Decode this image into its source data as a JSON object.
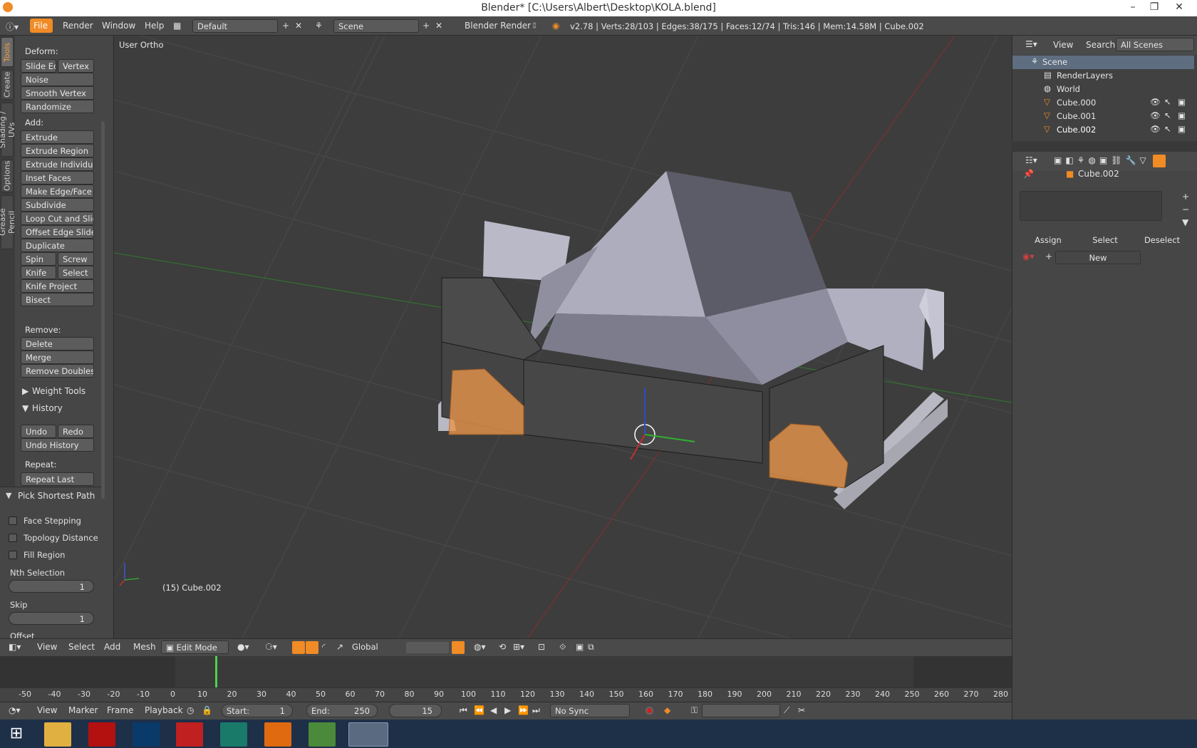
{
  "window": {
    "title": "Blender* [C:\\Users\\Albert\\Desktop\\KOLA.blend]",
    "min": "–",
    "max": "❐",
    "close": "✕"
  },
  "info": {
    "menus": [
      "File",
      "Render",
      "Window",
      "Help"
    ],
    "layout": "Default",
    "scene": "Scene",
    "engine": "Blender Render",
    "stats": "v2.78 | Verts:28/103 | Edges:38/175 | Faces:12/74 | Tris:146 | Mem:14.58M | Cube.002"
  },
  "tabs": [
    "Tools",
    "Create",
    "Shading / UVs",
    "Options",
    "Grease Pencil"
  ],
  "tools": {
    "deform": "Deform:",
    "slide_edge": "Slide Ed",
    "vertex": "Vertex",
    "noise": "Noise",
    "smooth_vertex": "Smooth Vertex",
    "randomize": "Randomize",
    "add": "Add:",
    "extrude": "Extrude",
    "extrude_region": "Extrude Region",
    "extrude_individual": "Extrude Individual",
    "inset_faces": "Inset Faces",
    "make_edge_face": "Make Edge/Face",
    "subdivide": "Subdivide",
    "loop_cut": "Loop Cut and Slide",
    "offset_edge": "Offset Edge Slide",
    "duplicate": "Duplicate",
    "spin": "Spin",
    "screw": "Screw",
    "knife": "Knife",
    "select": "Select",
    "knife_project": "Knife Project",
    "bisect": "Bisect",
    "remove": "Remove:",
    "delete": "Delete",
    "merge": "Merge",
    "remove_doubles": "Remove Doubles",
    "weight_tools": "Weight Tools",
    "history": "History",
    "undo": "Undo",
    "redo": "Redo",
    "undo_history": "Undo History",
    "repeat": "Repeat:",
    "repeat_last": "Repeat Last"
  },
  "operator": {
    "title": "Pick Shortest Path",
    "face_stepping": "Face Stepping",
    "topology_distance": "Topology Distance",
    "fill_region": "Fill Region",
    "nth": "Nth Selection",
    "nth_val": "1",
    "skip": "Skip",
    "skip_val": "1",
    "offset": "Offset"
  },
  "viewport": {
    "view_name": "User Ortho",
    "object_info": "(15) Cube.002"
  },
  "header3d": {
    "view": "View",
    "select": "Select",
    "add": "Add",
    "mesh": "Mesh",
    "mode": "Edit Mode",
    "orientation": "Global"
  },
  "timeline": {
    "ticks": [
      "-50",
      "-40",
      "-30",
      "-20",
      "-10",
      "0",
      "10",
      "20",
      "30",
      "40",
      "50",
      "60",
      "70",
      "80",
      "90",
      "100",
      "110",
      "120",
      "130",
      "140",
      "150",
      "160",
      "170",
      "180",
      "190",
      "200",
      "210",
      "220",
      "230",
      "240",
      "250",
      "260",
      "270",
      "280"
    ],
    "view": "View",
    "marker": "Marker",
    "frame": "Frame",
    "playback": "Playback",
    "start_label": "Start:",
    "start": "1",
    "end_label": "End:",
    "end": "250",
    "current": "15",
    "sync": "No Sync",
    "current_frame": 15
  },
  "outliner": {
    "view": "View",
    "search": "Search",
    "scope": "All Scenes",
    "rows": [
      "Scene",
      "RenderLayers",
      "World",
      "Cube.000",
      "Cube.001",
      "Cube.002"
    ]
  },
  "props": {
    "object": "Cube.002",
    "assign": "Assign",
    "select": "Select",
    "deselect": "Deselect",
    "new": "New"
  },
  "colors": {
    "accent": "#f08b25",
    "selected_face": "#e8954a",
    "grid": "#4a4a4a",
    "x_axis": "#b03030",
    "y_axis": "#3a9a3a"
  }
}
